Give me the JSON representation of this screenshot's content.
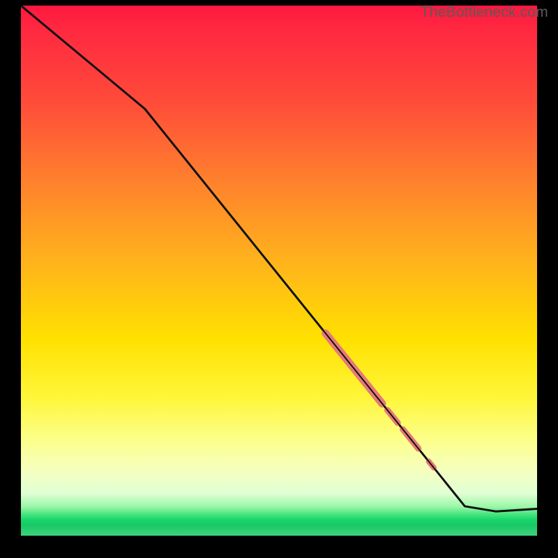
{
  "attribution": "TheBottleneck.com",
  "chart_data": {
    "type": "line",
    "title": "",
    "xlabel": "",
    "ylabel": "",
    "xlim": [
      0,
      100
    ],
    "ylim": [
      0,
      100
    ],
    "grid": false,
    "legend": false,
    "curve": [
      {
        "x": 0,
        "y": 100
      },
      {
        "x": 24,
        "y": 80
      },
      {
        "x": 86,
        "y": 3
      },
      {
        "x": 92,
        "y": 2
      },
      {
        "x": 100,
        "y": 2.5
      }
    ],
    "highlights": [
      {
        "x_start": 59,
        "x_end": 70,
        "width": 1.6
      },
      {
        "x_start": 71,
        "x_end": 73,
        "width": 1.4
      },
      {
        "x_start": 74,
        "x_end": 77,
        "width": 1.3
      },
      {
        "x_start": 79,
        "x_end": 80,
        "width": 1.2
      }
    ],
    "colors": {
      "curve": "#111111",
      "highlight": "#e67a77",
      "background_top": "#ff173f",
      "background_mid": "#ffe100",
      "background_bottom": "#19d76a"
    }
  }
}
